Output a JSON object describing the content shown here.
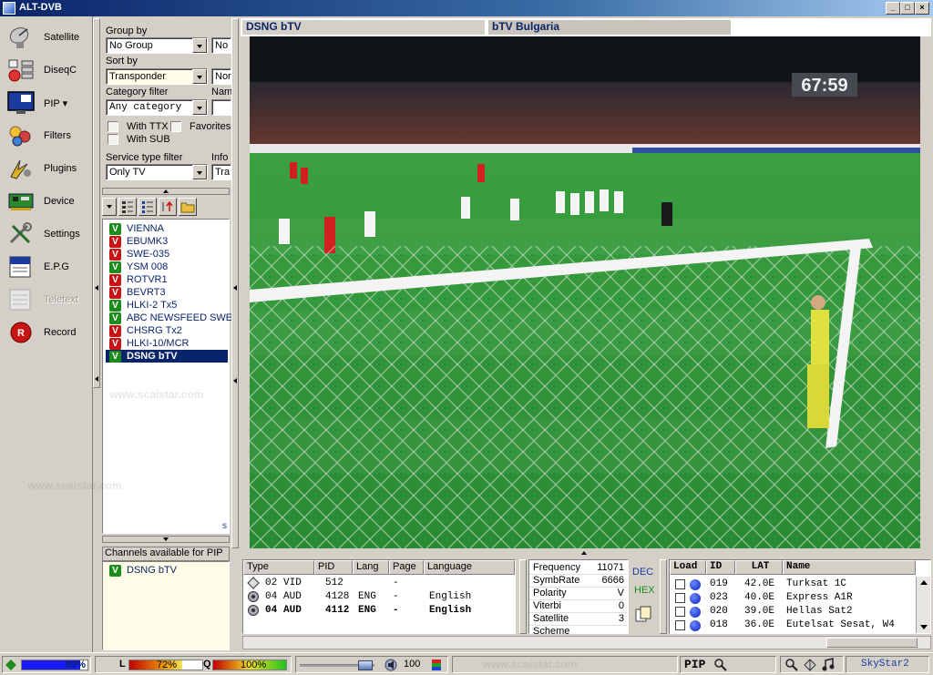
{
  "window": {
    "title": "ALT-DVB",
    "controls": [
      "_",
      "□",
      "×"
    ]
  },
  "nav": [
    {
      "label": "Satellite",
      "icon": "satellite-dish-icon"
    },
    {
      "label": "DiseqC",
      "icon": "diseqc-switch-icon"
    },
    {
      "label": "PIP",
      "icon": "pip-monitor-icon",
      "has_menu": true
    },
    {
      "label": "Filters",
      "icon": "filters-icon"
    },
    {
      "label": "Plugins",
      "icon": "plugins-icon"
    },
    {
      "label": "Device",
      "icon": "device-card-icon"
    },
    {
      "label": "Settings",
      "icon": "settings-tools-icon"
    },
    {
      "label": "E.P.G",
      "icon": "epg-icon"
    },
    {
      "label": "Teletext",
      "icon": "teletext-icon",
      "disabled": true
    },
    {
      "label": "Record",
      "icon": "record-icon"
    }
  ],
  "filters": {
    "group_by_label": "Group by",
    "group_by_value": "No Group",
    "group_by_extra": "No",
    "sort_by_label": "Sort by",
    "sort_by_value": "Transponder",
    "sort_by_extra": "Nor",
    "category_label": "Category filter",
    "category_value": "Any category",
    "name_label": "Nam",
    "with_ttx": "With TTX",
    "favorites": "Favorites",
    "with_sub": "With SUB",
    "service_type_label": "Service type filter",
    "service_type_value": "Only TV",
    "info_label": "Info",
    "info_value": "Tra"
  },
  "channels": [
    {
      "name": "VIENNA",
      "status": "green"
    },
    {
      "name": "EBUMK3",
      "status": "red"
    },
    {
      "name": "SWE-035",
      "status": "red"
    },
    {
      "name": "YSM 008",
      "status": "green"
    },
    {
      "name": "ROTVR1",
      "status": "red"
    },
    {
      "name": "BEVRT3",
      "status": "red"
    },
    {
      "name": "HLKI-2 Tx5",
      "status": "green"
    },
    {
      "name": "ABC NEWSFEED SWE.",
      "status": "green"
    },
    {
      "name": "CHSRG Tx2",
      "status": "red"
    },
    {
      "name": "HLKI-10/MCR",
      "status": "red"
    },
    {
      "name": "DSNG bTV",
      "status": "green",
      "selected": true
    }
  ],
  "channel_list_corner": "s",
  "pip": {
    "label": "Channels available for PIP",
    "channels": [
      "DSNG bTV"
    ]
  },
  "video": {
    "channel_tab": "DSNG bTV",
    "provider_tab": "bTV  Bulgaria",
    "clock": "67:59"
  },
  "streams": {
    "headers": [
      "Type",
      "PID",
      "Lang",
      "Page",
      "Language"
    ],
    "rows": [
      {
        "num": "02",
        "type": "VID",
        "pid": "512",
        "lang": "",
        "page": "-",
        "language": "",
        "bold": false
      },
      {
        "num": "04",
        "type": "AUD",
        "pid": "4128",
        "lang": "ENG",
        "page": "-",
        "language": "English",
        "bold": false
      },
      {
        "num": "04",
        "type": "AUD",
        "pid": "4112",
        "lang": "ENG",
        "page": "-",
        "language": "English",
        "bold": true
      }
    ]
  },
  "tuning": {
    "rows": [
      {
        "label": "Frequency",
        "value": "11071"
      },
      {
        "label": "SymbRate",
        "value": "6666"
      },
      {
        "label": "Polarity",
        "value": "V"
      },
      {
        "label": "Viterbi",
        "value": "0"
      },
      {
        "label": "Satellite",
        "value": "3"
      },
      {
        "label": "Scheme",
        "value": ""
      }
    ],
    "dec": "DEC",
    "hex": "HEX"
  },
  "satellites": {
    "headers": [
      "Load",
      "ID",
      "LAT",
      "Name"
    ],
    "rows": [
      {
        "id": "019",
        "lat": "42.0E",
        "name": "Turksat 1C"
      },
      {
        "id": "023",
        "lat": "40.0E",
        "name": "Express A1R"
      },
      {
        "id": "020",
        "lat": "39.0E",
        "name": "Hellas Sat2"
      },
      {
        "id": "018",
        "lat": "36.0E",
        "name": "Eutelsat Sesat, W4"
      }
    ]
  },
  "status": {
    "signal_percent": "89%",
    "signal_value": 0.89,
    "level_label": "L",
    "level_percent": "72%",
    "level_value": 0.72,
    "quality_label": "Q",
    "quality_percent": "100%",
    "quality_value": 1.0,
    "volume": "100",
    "pip_label": "PIP",
    "device": "SkyStar2"
  },
  "watermark": "www.scaistar.com",
  "colors": {
    "accent": "#0a246a",
    "green_v": "#1c8c1c",
    "red_v": "#c81414",
    "pip_bg": "#fffde8"
  }
}
